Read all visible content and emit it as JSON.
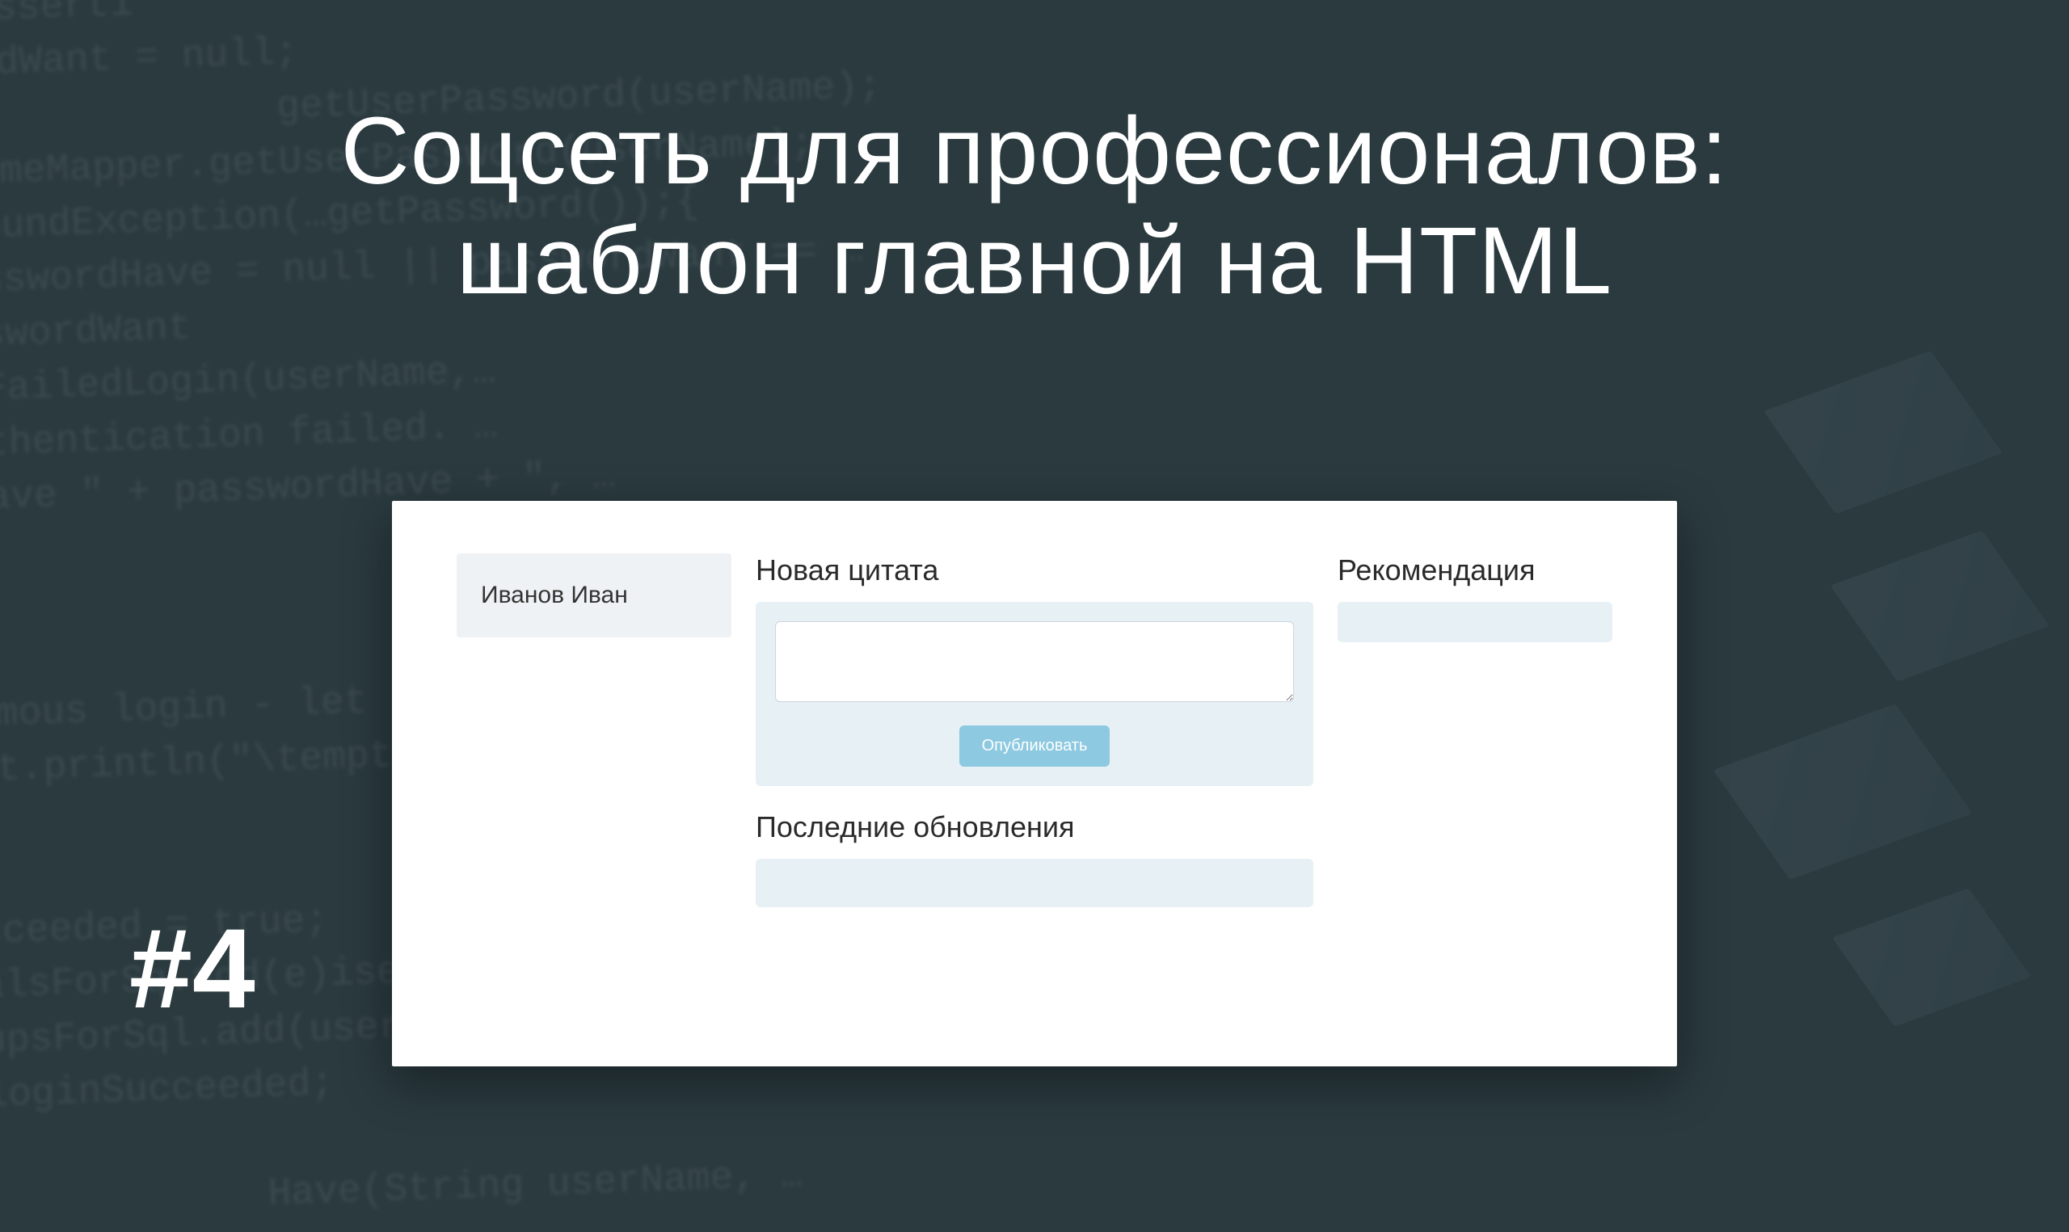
{
  "title": {
    "line1": "Соцсеть для профессионалов:",
    "line2": "шаблон главной на HTML"
  },
  "episode": "#4",
  "app": {
    "sidebar": {
      "user_name": "Иванов Иван"
    },
    "main": {
      "new_quote_heading": "Новая цитата",
      "publish_button": "Опубликовать",
      "updates_heading": "Последние обновления"
    },
    "right": {
      "recommendation_heading": "Рекомендация"
    }
  },
  "bg_code": "yAsserti\nbrdWant = null;\n              getUserPassword(userName);\nNameMapper.getUserPassword(userName);\nFoundException(…getPassword());{\nasswordHave = null || passwordWant == …\nsswordWant\nwFailedLogin(userName,…\nuthentication failed. …\nHave \" + passwordHave + \", …\n\n\n\nymous login - let i\nut.println(\"\\tempty\n\n\ncceeded = true;\nalsForSq.add(e)iserNa\nupsForSql.add(userName));\nloginSucceeded;\n\n            Have(String userName, …"
}
